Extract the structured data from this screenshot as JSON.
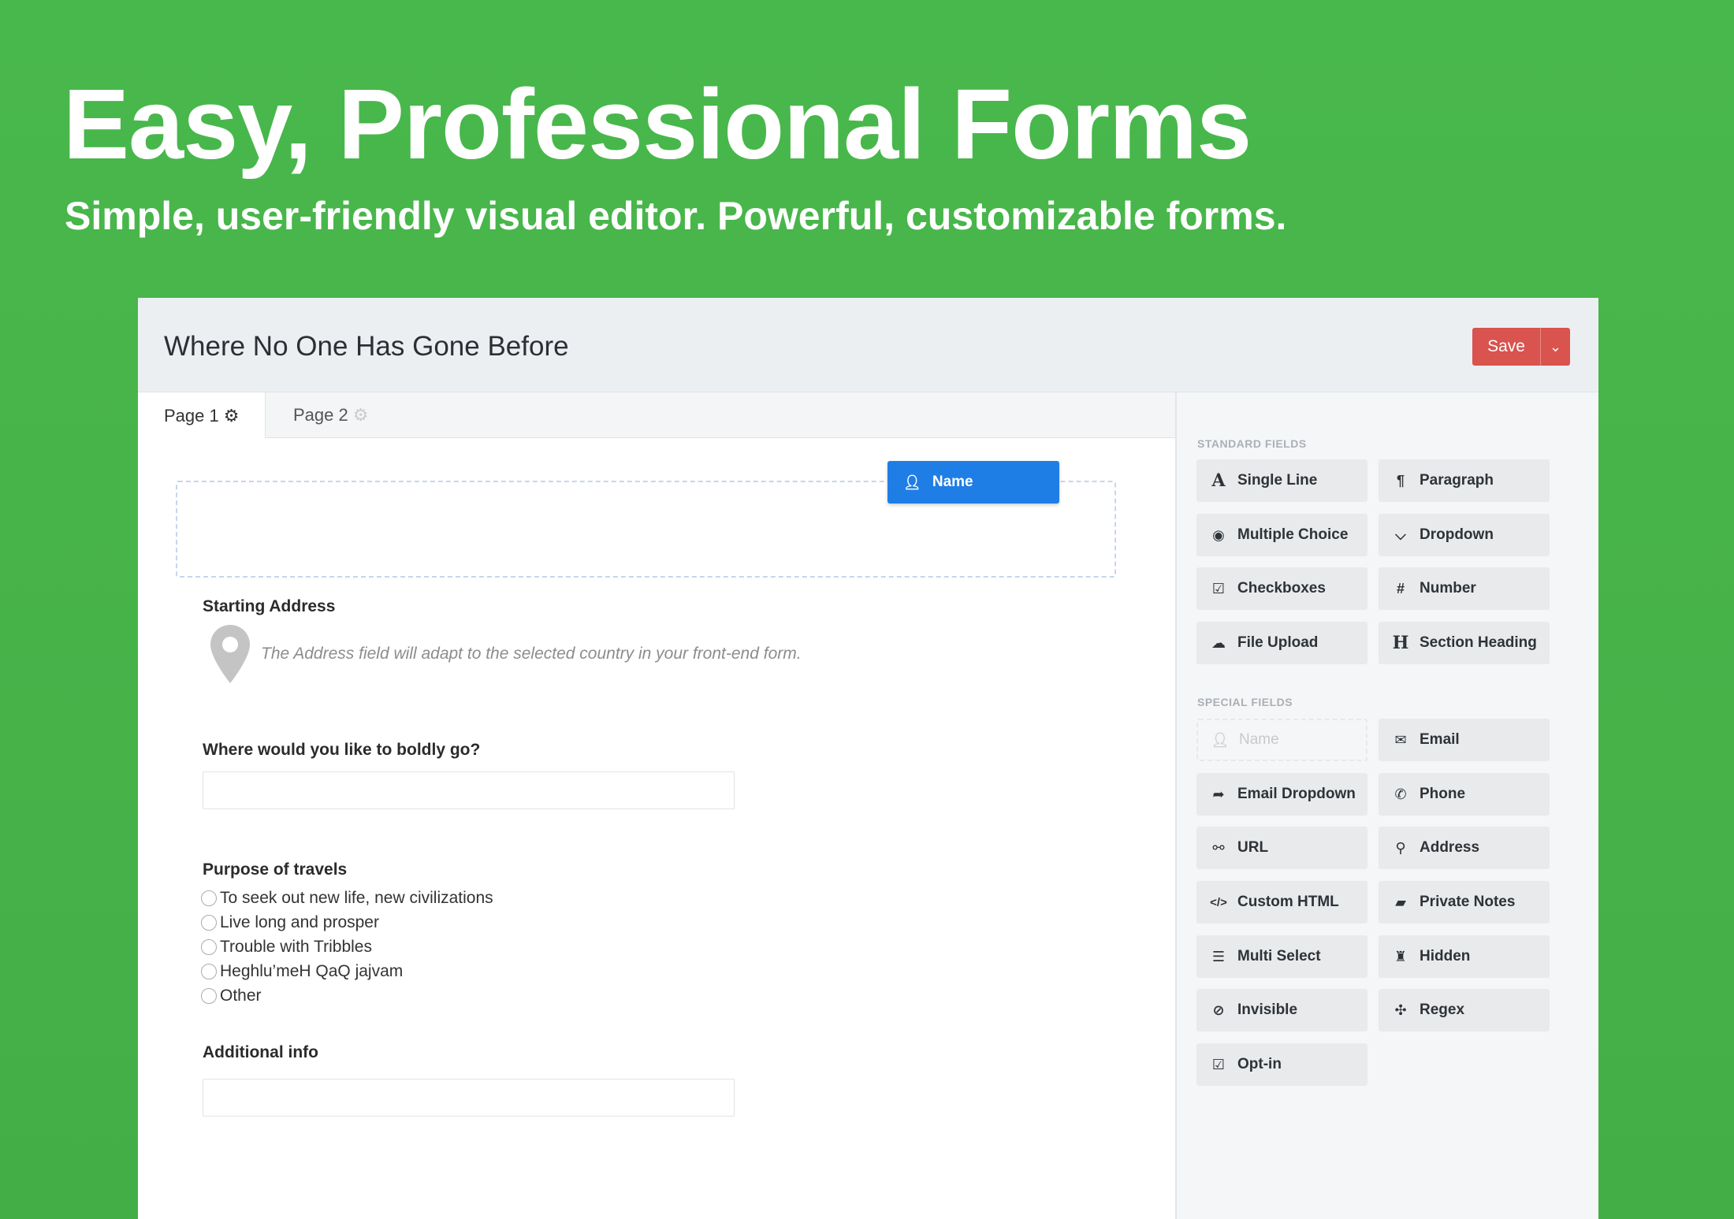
{
  "hero": {
    "title": "Easy, Professional Forms",
    "subtitle": "Simple, user-friendly visual editor. Powerful, customizable forms."
  },
  "window": {
    "title": "Where No One Has Gone Before",
    "save_label": "Save"
  },
  "tabs": [
    {
      "label": "Page 1"
    },
    {
      "label": "Page 2"
    }
  ],
  "form": {
    "dragged_field": "Name",
    "starting_address_label": "Starting Address",
    "address_note": "The Address field will adapt to the selected country in your front-end form.",
    "destination_label": "Where would you like to boldly go?",
    "purpose_label": "Purpose of travels",
    "purpose_options": [
      "To seek out new life, new civilizations",
      "Live long and prosper",
      "Trouble with Tribbles",
      "Heghlu’meH QaQ jajvam",
      "Other"
    ],
    "additional_label": "Additional info"
  },
  "sidebar": {
    "standard_heading": "STANDARD FIELDS",
    "standard_fields": [
      {
        "label": "Single Line",
        "icon": "text-a-icon"
      },
      {
        "label": "Paragraph",
        "icon": "pilcrow-icon"
      },
      {
        "label": "Multiple Choice",
        "icon": "radio-icon"
      },
      {
        "label": "Dropdown",
        "icon": "dropdown-icon"
      },
      {
        "label": "Checkboxes",
        "icon": "checkbox-icon"
      },
      {
        "label": "Number",
        "icon": "hash-icon"
      },
      {
        "label": "File Upload",
        "icon": "cloud-upload-icon"
      },
      {
        "label": "Section Heading",
        "icon": "heading-icon"
      }
    ],
    "special_heading": "SPECIAL FIELDS",
    "special_fields": [
      {
        "label": "Name",
        "icon": "user-icon"
      },
      {
        "label": "Email",
        "icon": "envelope-icon"
      },
      {
        "label": "Email Dropdown",
        "icon": "share-arrow-icon"
      },
      {
        "label": "Phone",
        "icon": "phone-icon"
      },
      {
        "label": "URL",
        "icon": "link-icon"
      },
      {
        "label": "Address",
        "icon": "map-pin-icon"
      },
      {
        "label": "Custom HTML",
        "icon": "code-icon"
      },
      {
        "label": "Private Notes",
        "icon": "note-icon"
      },
      {
        "label": "Multi Select",
        "icon": "list-icon"
      },
      {
        "label": "Hidden",
        "icon": "spy-icon"
      },
      {
        "label": "Invisible",
        "icon": "eye-slash-icon"
      },
      {
        "label": "Regex",
        "icon": "puzzle-icon"
      },
      {
        "label": "Opt-in",
        "icon": "checkbox-icon"
      }
    ]
  },
  "colors": {
    "background": "#49b84c",
    "save": "#d9534f",
    "accent": "#1f7ee6"
  }
}
